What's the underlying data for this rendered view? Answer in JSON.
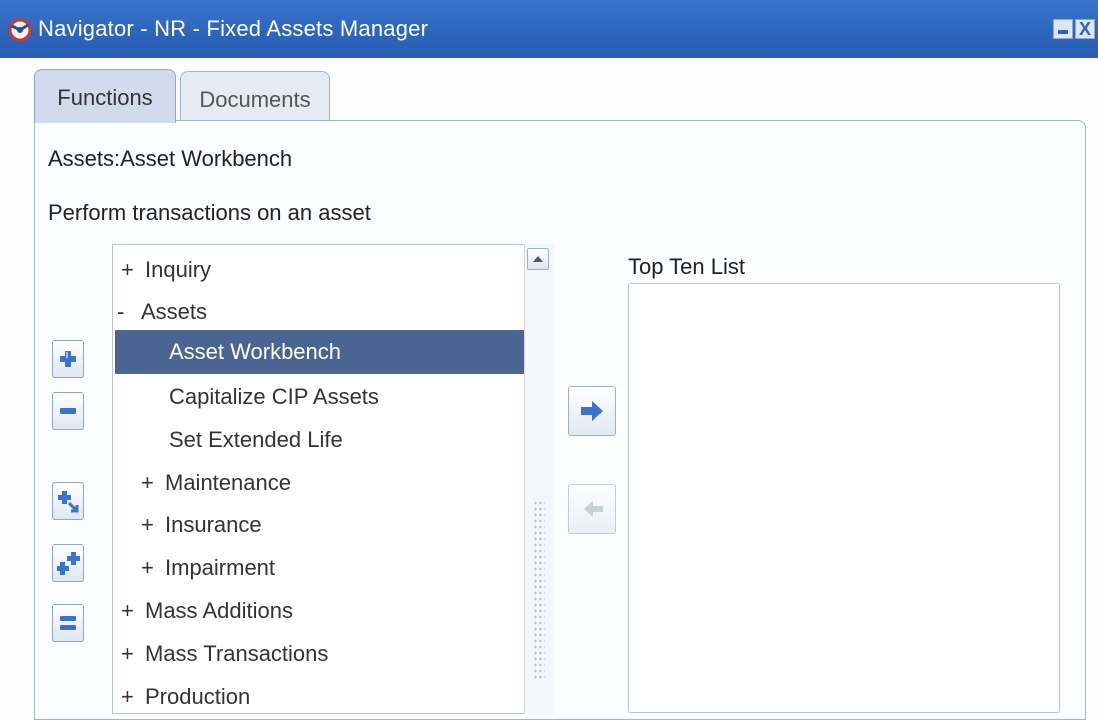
{
  "window": {
    "title": "Navigator - NR - Fixed Assets Manager",
    "minimize_icon": "minimize-icon",
    "close_label": "X"
  },
  "tabs": [
    {
      "label": "Functions",
      "active": true
    },
    {
      "label": "Documents",
      "active": false
    }
  ],
  "function": {
    "title": "Assets:Asset Workbench",
    "description": "Perform transactions on an asset"
  },
  "side_toolbar": [
    "expand-icon",
    "collapse-icon",
    "expand-branch-icon",
    "expand-all-icon",
    "collapse-all-icon"
  ],
  "tree": {
    "items": [
      {
        "prefix": "+",
        "label": "Inquiry",
        "level": 0
      },
      {
        "prefix": "-",
        "label": "Assets",
        "level": 0
      },
      {
        "prefix": "",
        "label": "Asset Workbench",
        "level": 1,
        "selected": true
      },
      {
        "prefix": "",
        "label": "Capitalize CIP Assets",
        "level": 1
      },
      {
        "prefix": "",
        "label": "Set Extended Life",
        "level": 1
      },
      {
        "prefix": "+",
        "label": "Maintenance",
        "level": 1
      },
      {
        "prefix": "+",
        "label": "Insurance",
        "level": 1
      },
      {
        "prefix": "+",
        "label": "Impairment",
        "level": 1
      },
      {
        "prefix": "+",
        "label": "Mass Additions",
        "level": 0
      },
      {
        "prefix": "+",
        "label": "Mass Transactions",
        "level": 0
      },
      {
        "prefix": "+",
        "label": "Production",
        "level": 0
      }
    ]
  },
  "top_ten": {
    "label": "Top Ten List",
    "items": []
  },
  "colors": {
    "titlebar": "#2d64bb",
    "selected_row": "#4a6591",
    "active_tab": "#d0dced",
    "button_icon": "#3b73c9"
  }
}
